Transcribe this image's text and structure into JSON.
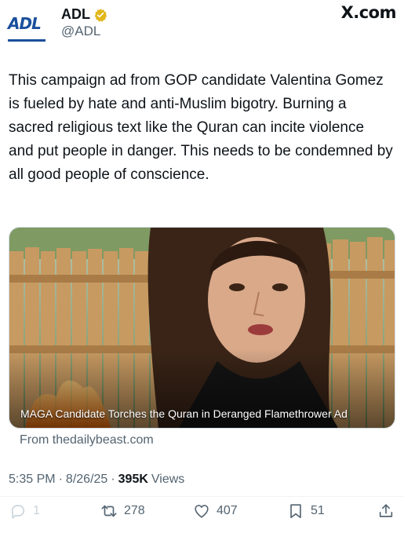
{
  "header": {
    "logo_text": "ADL",
    "display_name": "ADL",
    "handle": "@ADL",
    "site_mark": "X.com"
  },
  "tweet": {
    "text": "This campaign ad from GOP candidate Valentina Gomez is fueled by hate and anti-Muslim bigotry. Burning a sacred religious text like the Quran can incite violence and put people in danger. This needs to be condemned by all good people of conscience."
  },
  "media": {
    "caption": "MAGA Candidate Torches the Quran in Deranged Flamethrower Ad",
    "link_source": "From thedailybeast.com"
  },
  "meta": {
    "time": "5:35 PM",
    "separator": "·",
    "date": "8/26/25",
    "views_count": "395K",
    "views_label": "Views"
  },
  "actions": {
    "replies": "1",
    "retweets": "278",
    "likes": "407",
    "bookmarks": "51"
  },
  "colors": {
    "verified": "#e2b719",
    "logo": "#1a4f9c",
    "secondary_text": "#536471"
  }
}
